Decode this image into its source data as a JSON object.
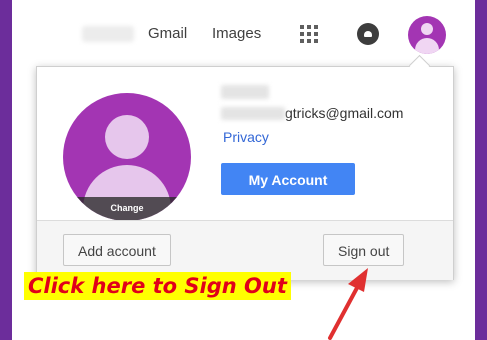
{
  "topbar": {
    "gmail": "Gmail",
    "images": "Images",
    "apps_icon": "apps-grid-icon",
    "notification_icon": "notifications-icon",
    "avatar_icon": "account-avatar-icon"
  },
  "account": {
    "avatar_change": "Change",
    "email_suffix": "gtricks@gmail.com",
    "privacy": "Privacy",
    "my_account": "My Account"
  },
  "footer": {
    "add_account": "Add account",
    "sign_out": "Sign out"
  },
  "annotation": {
    "text": "Click here to Sign Out",
    "text_color": "#e0001a",
    "highlight_color": "#ffff00",
    "arrow_color": "#e03030"
  },
  "colors": {
    "frame_border": "#6c2d9b",
    "avatar": "#a335b3",
    "primary_button": "#4285f4",
    "link": "#3367d6"
  }
}
